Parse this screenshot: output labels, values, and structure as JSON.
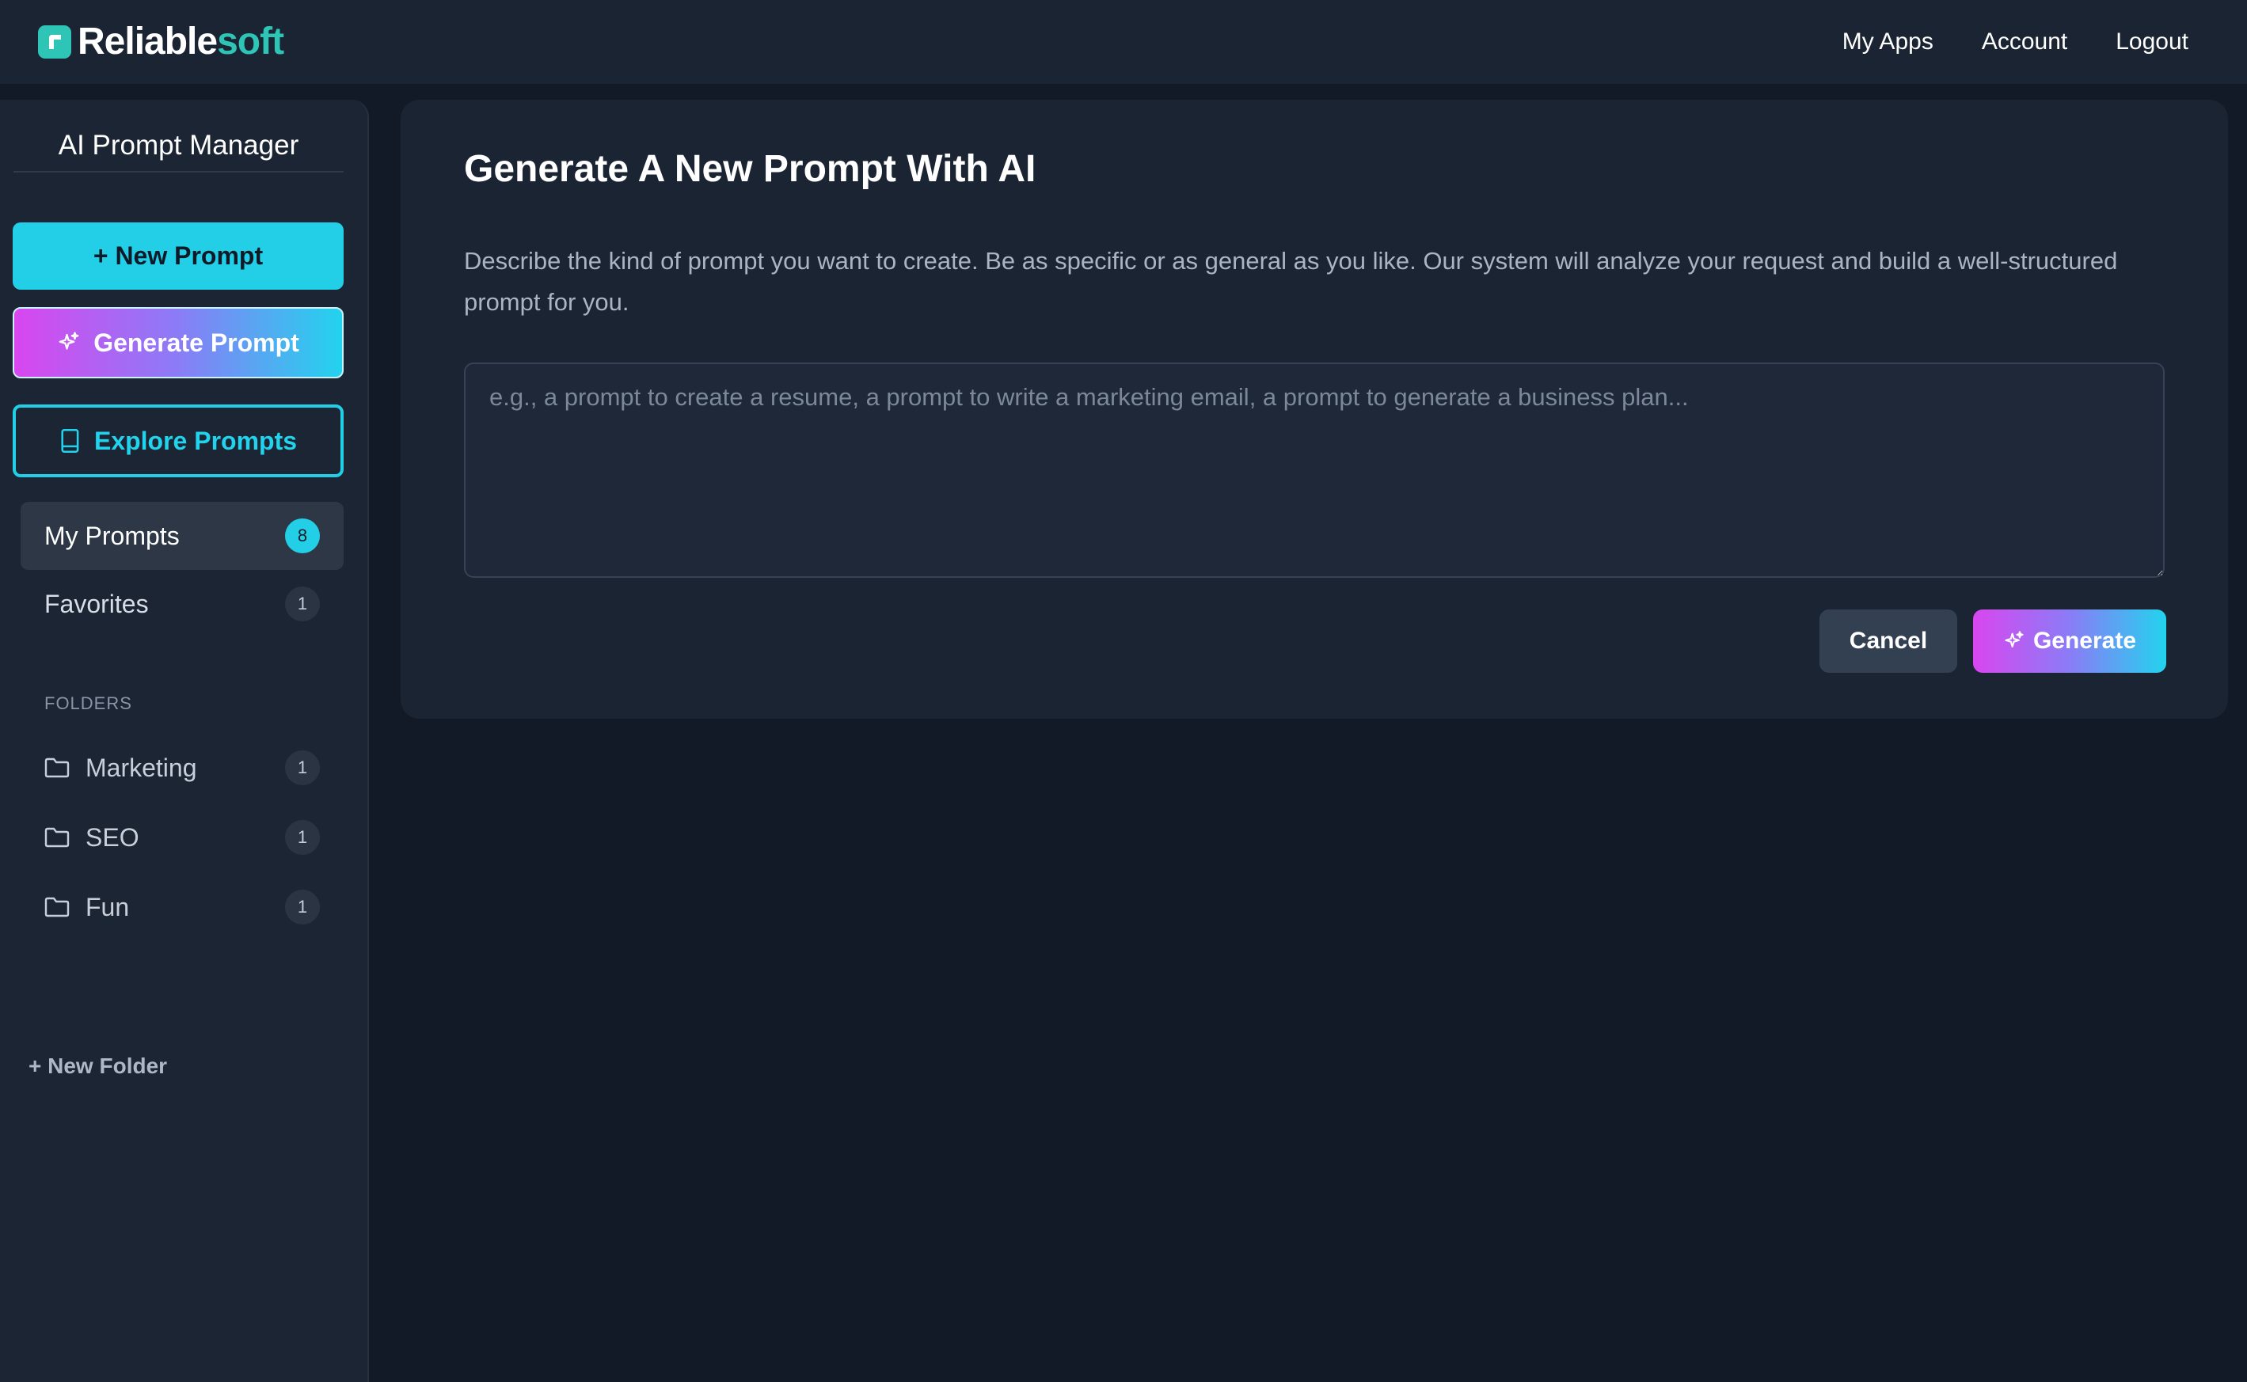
{
  "header": {
    "brand": {
      "part1": "Reliable",
      "part2": "soft",
      "logo_icon": "reliablesoft-logo-icon"
    },
    "nav": [
      {
        "label": "My Apps"
      },
      {
        "label": "Account"
      },
      {
        "label": "Logout"
      }
    ]
  },
  "sidebar": {
    "title": "AI Prompt Manager",
    "new_prompt_label": "+ New Prompt",
    "generate_prompt_label": "Generate Prompt",
    "explore_prompts_label": "Explore Prompts",
    "items": [
      {
        "label": "My Prompts",
        "count": "8",
        "active": true
      },
      {
        "label": "Favorites",
        "count": "1",
        "active": false
      }
    ],
    "folders_heading": "FOLDERS",
    "folders": [
      {
        "label": "Marketing",
        "count": "1",
        "icon": "folder-icon"
      },
      {
        "label": "SEO",
        "count": "1",
        "icon": "folder-icon"
      },
      {
        "label": "Fun",
        "count": "1",
        "icon": "folder-icon"
      }
    ],
    "new_folder_label": "+ New Folder"
  },
  "main": {
    "title": "Generate A New Prompt With AI",
    "description": "Describe the kind of prompt you want to create. Be as specific or as general as you like. Our system will analyze your request and build a well-structured prompt for you.",
    "textarea": {
      "value": "",
      "placeholder": "e.g., a prompt to create a resume, a prompt to write a marketing email, a prompt to generate a business plan..."
    },
    "cancel_label": "Cancel",
    "generate_label": "Generate"
  },
  "colors": {
    "accent_cyan": "#22cfe6",
    "accent_magenta": "#d946ef",
    "brand_teal": "#2ec4b6",
    "background": "#131a27"
  }
}
